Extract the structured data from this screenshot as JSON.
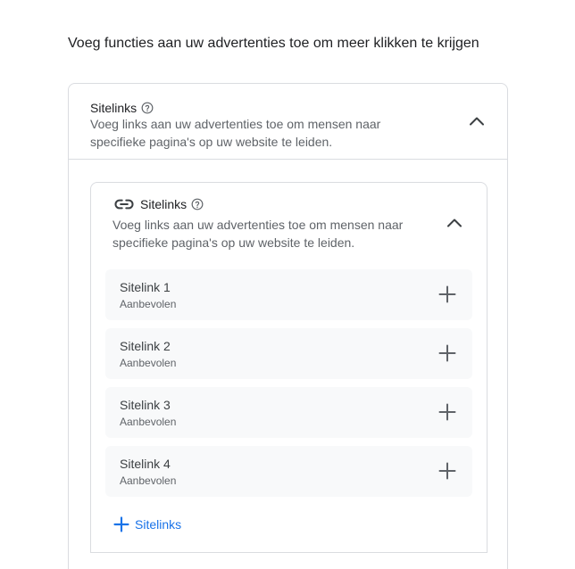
{
  "page": {
    "title": "Voeg functies aan uw advertenties toe om meer klikken te krijgen"
  },
  "outer_section": {
    "title": "Sitelinks",
    "description": "Voeg links aan uw advertenties toe om mensen naar specifieke pagina's op uw website te leiden.",
    "help_icon": "help-circle-icon",
    "chevron_icon": "chevron-up-icon"
  },
  "inner_section": {
    "icon": "link-icon",
    "title": "Sitelinks",
    "description": "Voeg links aan uw advertenties toe om mensen naar specifieke pagina's op uw website te leiden.",
    "help_icon": "help-circle-icon",
    "chevron_icon": "chevron-up-icon"
  },
  "sitelinks": [
    {
      "name": "Sitelink 1",
      "tag": "Aanbevolen"
    },
    {
      "name": "Sitelink 2",
      "tag": "Aanbevolen"
    },
    {
      "name": "Sitelink 3",
      "tag": "Aanbevolen"
    },
    {
      "name": "Sitelink 4",
      "tag": "Aanbevolen"
    }
  ],
  "add_button": {
    "label": "Sitelinks",
    "icon": "plus-icon"
  },
  "colors": {
    "text_primary": "#202124",
    "text_secondary": "#5f6368",
    "border": "#dadce0",
    "item_bg": "#f8f9fa",
    "accent": "#1a73e8"
  }
}
